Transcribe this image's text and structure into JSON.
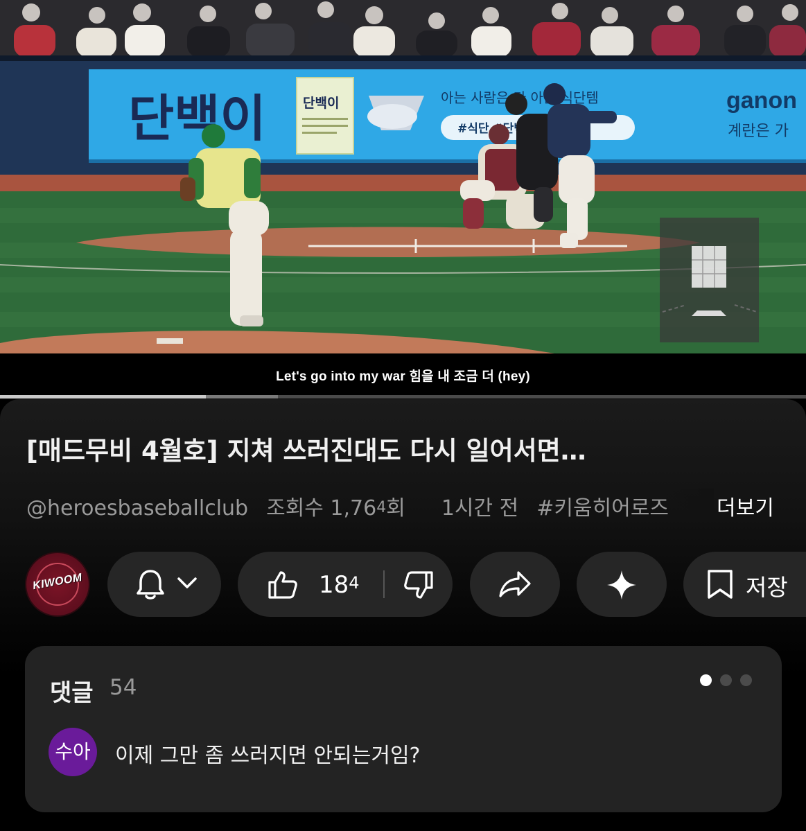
{
  "video": {
    "subtitle": "Let's go into my war 힘을 내 조금 더 (hey)",
    "banner_brand": "단백이",
    "banner_package_label": "단백이",
    "banner_copy": "아는 사람은 다 아는 식단템",
    "banner_tags": "#식단  #단백한2알",
    "banner_sponsor": "ganon",
    "banner_sponsor_sub": "계란은 가",
    "progress_played": 0.255,
    "progress_buffered": 0.345
  },
  "title": "[매드무비 4월호] 지쳐 쓰러진대도 다시 일어서면…",
  "meta": {
    "channel": "@heroesbaseballclub",
    "views": "조회수 1,76",
    "views_suffix": "회",
    "time": "1시간 전",
    "hashtag": "#키움히어로즈",
    "more": "더보기"
  },
  "channel_avatar": {
    "text": "KIWOOM"
  },
  "actions": {
    "like_count": "18",
    "save_label": "저장",
    "icons": [
      "bell-icon",
      "chevron-down-icon",
      "thumbs-up-icon",
      "thumbs-down-icon",
      "share-icon",
      "sparkle-icon",
      "bookmark-icon"
    ]
  },
  "comments": {
    "title": "댓글",
    "count": "54",
    "first": {
      "author_initials": "수아",
      "text": "이제 그만 좀 쓰러지면 안되는거임?"
    },
    "avatar_color": "#6a1b9a"
  },
  "colors": {
    "background": "#000000",
    "pill": "#262626",
    "comment_card": "#232323",
    "secondary_text": "#9a9a9a",
    "banner_blue": "#2fa8e6"
  }
}
